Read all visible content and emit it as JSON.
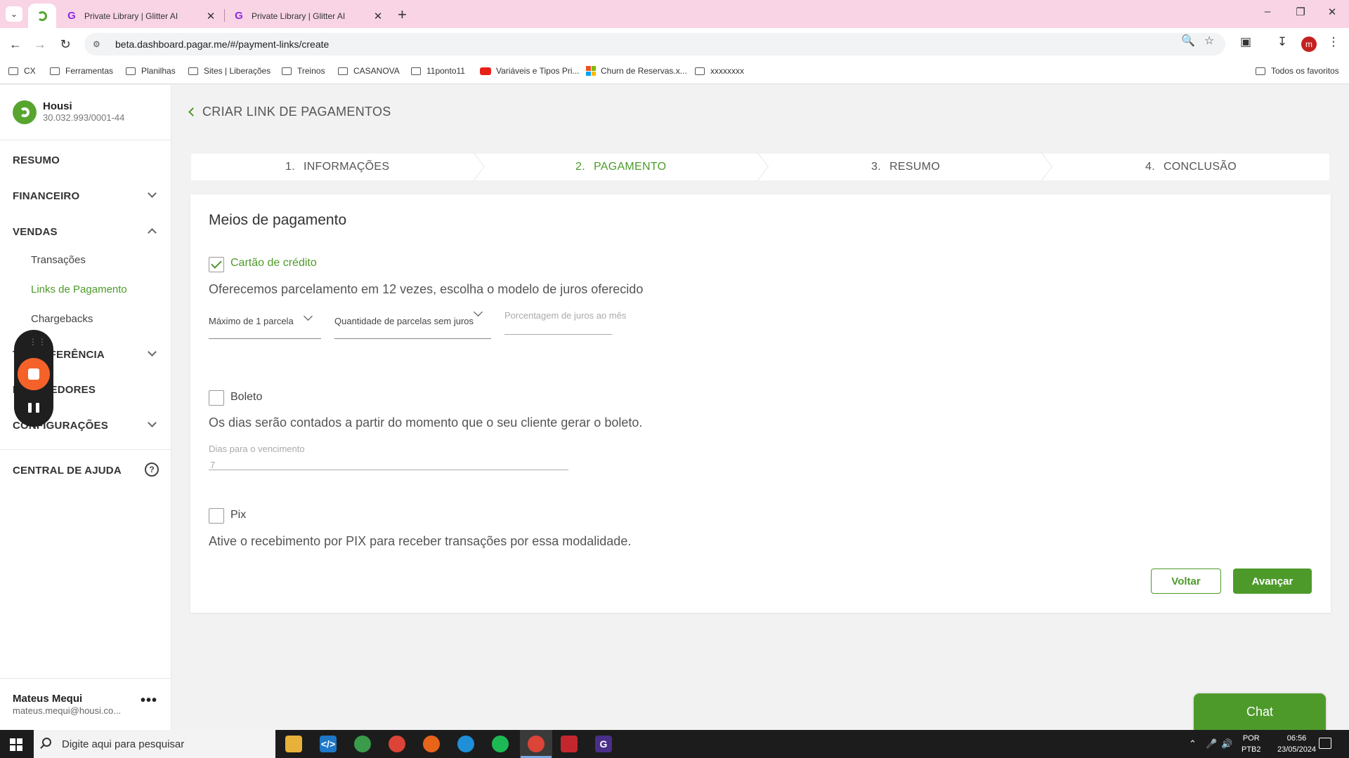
{
  "browser": {
    "tabs": [
      {
        "title": "Private Library | Glitter AI"
      },
      {
        "title": "Private Library | Glitter AI"
      }
    ],
    "url": "beta.dashboard.pagar.me/#/payment-links/create",
    "profile_initial": "m",
    "bookmarks": [
      {
        "label": "CX",
        "icon": "folder-icon"
      },
      {
        "label": "Ferramentas",
        "icon": "folder-icon"
      },
      {
        "label": "Planilhas",
        "icon": "folder-icon"
      },
      {
        "label": "Sites | Liberações",
        "icon": "folder-icon"
      },
      {
        "label": "Treinos",
        "icon": "folder-icon"
      },
      {
        "label": "CASANOVA",
        "icon": "folder-icon"
      },
      {
        "label": "11ponto11",
        "icon": "folder-icon"
      },
      {
        "label": "Variáveis e Tipos Pri...",
        "icon": "youtube-icon"
      },
      {
        "label": "Churn de Reservas.x...",
        "icon": "microsoft-icon"
      },
      {
        "label": "xxxxxxxx",
        "icon": "folder-icon"
      }
    ],
    "all_bookmarks": "Todos os favoritos"
  },
  "sidebar": {
    "company_name": "Housi",
    "company_cnpj": "30.032.993/0001-44",
    "nav": {
      "resumo": "RESUMO",
      "financeiro": "FINANCEIRO",
      "vendas": "VENDAS",
      "transacoes": "Transações",
      "links_pagamento": "Links de Pagamento",
      "chargebacks": "Chargebacks",
      "transferencia": "TRANSFERÊNCIA",
      "recebedores": "RECEBEDORES",
      "configuracoes": "CONFIGURAÇÕES",
      "central_ajuda": "CENTRAL DE AJUDA"
    },
    "user": {
      "name": "Mateus Mequi",
      "email": "mateus.mequi@housi.co..."
    }
  },
  "page": {
    "title": "CRIAR LINK DE PAGAMENTOS",
    "steps": [
      {
        "num": "1.",
        "label": "INFORMAÇÕES"
      },
      {
        "num": "2.",
        "label": "PAGAMENTO"
      },
      {
        "num": "3.",
        "label": "RESUMO"
      },
      {
        "num": "4.",
        "label": "CONCLUSÃO"
      }
    ],
    "active_step": 2,
    "card": {
      "title": "Meios de pagamento",
      "credit": {
        "label": "Cartão de crédito",
        "checked": true,
        "description": "Oferecemos parcelamento em 12 vezes, escolha o modelo de juros oferecido",
        "max_installments": "Máximo de 1 parcela",
        "installments_no_interest": "Quantidade de parcelas sem juros",
        "interest_placeholder": "Porcentagem de juros ao mês"
      },
      "boleto": {
        "label": "Boleto",
        "checked": false,
        "description": "Os dias serão contados a partir do momento que o seu cliente gerar o boleto.",
        "days_label": "Dias para o vencimento",
        "days_value": "7"
      },
      "pix": {
        "label": "Pix",
        "checked": false,
        "description": "Ative o recebimento por PIX para receber transações por essa modalidade."
      },
      "back_button": "Voltar",
      "next_button": "Avançar"
    },
    "chat_button": "Chat"
  },
  "taskbar": {
    "search_placeholder": "Digite aqui para pesquisar",
    "lang_top": "POR",
    "lang_bottom": "PTB2",
    "time": "06:56",
    "date": "23/05/2024"
  }
}
